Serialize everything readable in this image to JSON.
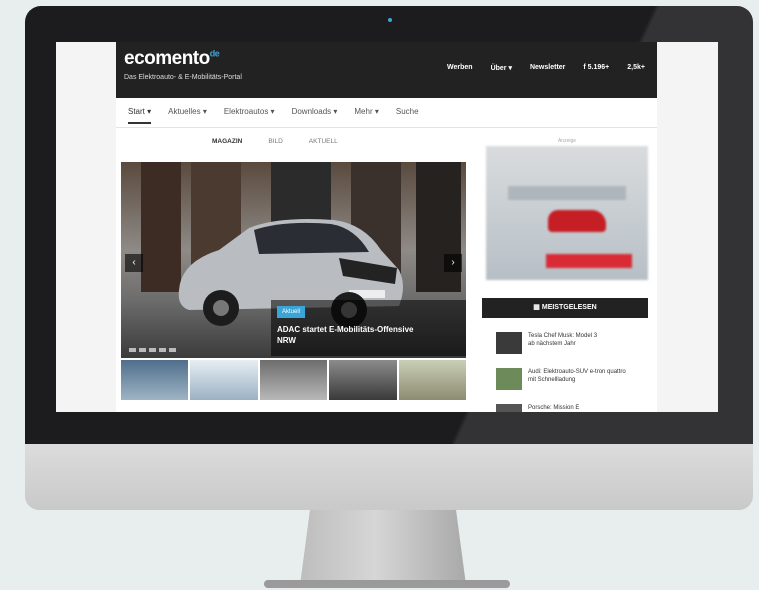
{
  "site": {
    "logo_text": "ecomento",
    "logo_suffix": "de",
    "tagline": "Das Elektroauto- & E-Mobilitäts-Portal",
    "topnav": [
      "Werben",
      "Über ▾",
      "Newsletter",
      "f 5.196+",
      "2,5k+"
    ]
  },
  "menu": {
    "items": [
      "Start ▾",
      "Aktuelles ▾",
      "Elektroautos ▾",
      "Downloads ▾",
      "Mehr ▾",
      "Suche"
    ]
  },
  "tabs": [
    "MAGAZIN",
    "BILD",
    "AKTUELL"
  ],
  "slider": {
    "badge": "Aktuell",
    "caption_line1": "ADAC startet E-Mobilitäts-Offensive",
    "caption_line2": "NRW"
  },
  "sidebar": {
    "ad_label": "Anzeige",
    "meist_title": "MEISTGELESEN",
    "list": [
      {
        "line1": "Tesla Chef Musk: Model 3",
        "line2": "ab nächstem Jahr"
      },
      {
        "line1": "Audi: Elektroauto-SUV e-tron quattro",
        "line2": "mit Schnellladung"
      },
      {
        "line1": "Porsche: Mission E",
        "line2": ""
      }
    ]
  },
  "colors": {
    "accent": "#3aa5d8",
    "topbar": "#222222"
  }
}
